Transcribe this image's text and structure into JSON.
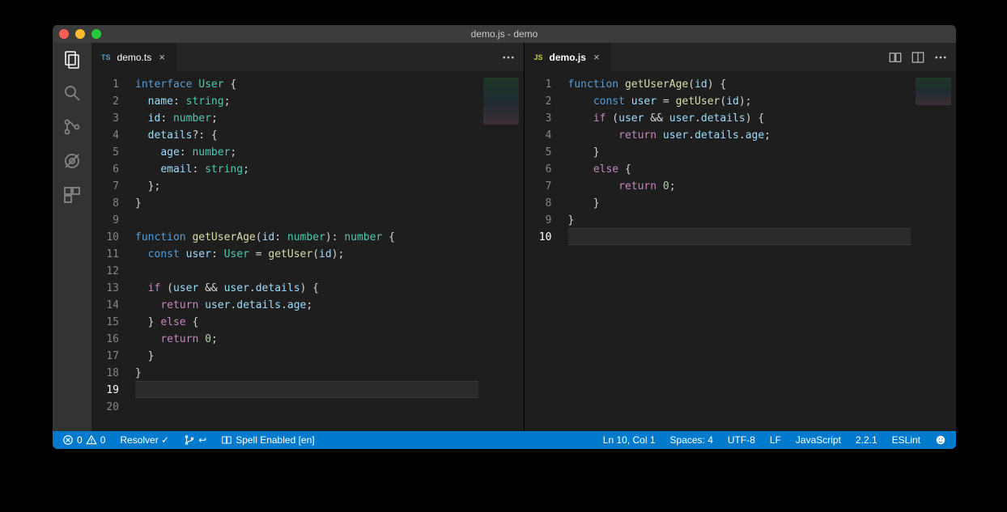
{
  "window": {
    "title": "demo.js - demo"
  },
  "leftEditor": {
    "tab": {
      "lang": "TS",
      "name": "demo.ts"
    },
    "lines": [
      [
        {
          "t": "interface ",
          "c": "kw"
        },
        {
          "t": "User ",
          "c": "type"
        },
        {
          "t": "{",
          "c": "pun"
        }
      ],
      [
        {
          "t": "  ",
          "c": ""
        },
        {
          "t": "name",
          "c": "var"
        },
        {
          "t": ": ",
          "c": "pun"
        },
        {
          "t": "string",
          "c": "type"
        },
        {
          "t": ";",
          "c": "pun"
        }
      ],
      [
        {
          "t": "  ",
          "c": ""
        },
        {
          "t": "id",
          "c": "var"
        },
        {
          "t": ": ",
          "c": "pun"
        },
        {
          "t": "number",
          "c": "type"
        },
        {
          "t": ";",
          "c": "pun"
        }
      ],
      [
        {
          "t": "  ",
          "c": ""
        },
        {
          "t": "details",
          "c": "var"
        },
        {
          "t": "?: {",
          "c": "pun"
        }
      ],
      [
        {
          "t": "    ",
          "c": ""
        },
        {
          "t": "age",
          "c": "var"
        },
        {
          "t": ": ",
          "c": "pun"
        },
        {
          "t": "number",
          "c": "type"
        },
        {
          "t": ";",
          "c": "pun"
        }
      ],
      [
        {
          "t": "    ",
          "c": ""
        },
        {
          "t": "email",
          "c": "var"
        },
        {
          "t": ": ",
          "c": "pun"
        },
        {
          "t": "string",
          "c": "type"
        },
        {
          "t": ";",
          "c": "pun"
        }
      ],
      [
        {
          "t": "  };",
          "c": "pun"
        }
      ],
      [
        {
          "t": "}",
          "c": "pun"
        }
      ],
      [
        {
          "t": "",
          "c": ""
        }
      ],
      [
        {
          "t": "function ",
          "c": "kw"
        },
        {
          "t": "getUserAge",
          "c": "fn"
        },
        {
          "t": "(",
          "c": "pun"
        },
        {
          "t": "id",
          "c": "var"
        },
        {
          "t": ": ",
          "c": "pun"
        },
        {
          "t": "number",
          "c": "type"
        },
        {
          "t": "): ",
          "c": "pun"
        },
        {
          "t": "number ",
          "c": "type"
        },
        {
          "t": "{",
          "c": "pun"
        }
      ],
      [
        {
          "t": "  ",
          "c": ""
        },
        {
          "t": "const ",
          "c": "kw"
        },
        {
          "t": "user",
          "c": "var"
        },
        {
          "t": ": ",
          "c": "pun"
        },
        {
          "t": "User",
          "c": "type"
        },
        {
          "t": " = ",
          "c": "pun"
        },
        {
          "t": "getUser",
          "c": "fn"
        },
        {
          "t": "(",
          "c": "pun"
        },
        {
          "t": "id",
          "c": "var"
        },
        {
          "t": ");",
          "c": "pun"
        }
      ],
      [
        {
          "t": "",
          "c": ""
        }
      ],
      [
        {
          "t": "  ",
          "c": ""
        },
        {
          "t": "if ",
          "c": "kw2"
        },
        {
          "t": "(",
          "c": "pun"
        },
        {
          "t": "user",
          "c": "var"
        },
        {
          "t": " && ",
          "c": "pun"
        },
        {
          "t": "user",
          "c": "var"
        },
        {
          "t": ".",
          "c": "pun"
        },
        {
          "t": "details",
          "c": "var"
        },
        {
          "t": ") {",
          "c": "pun"
        }
      ],
      [
        {
          "t": "    ",
          "c": ""
        },
        {
          "t": "return ",
          "c": "kw2"
        },
        {
          "t": "user",
          "c": "var"
        },
        {
          "t": ".",
          "c": "pun"
        },
        {
          "t": "details",
          "c": "var"
        },
        {
          "t": ".",
          "c": "pun"
        },
        {
          "t": "age",
          "c": "var"
        },
        {
          "t": ";",
          "c": "pun"
        }
      ],
      [
        {
          "t": "  } ",
          "c": "pun"
        },
        {
          "t": "else ",
          "c": "kw2"
        },
        {
          "t": "{",
          "c": "pun"
        }
      ],
      [
        {
          "t": "    ",
          "c": ""
        },
        {
          "t": "return ",
          "c": "kw2"
        },
        {
          "t": "0",
          "c": "num"
        },
        {
          "t": ";",
          "c": "pun"
        }
      ],
      [
        {
          "t": "  }",
          "c": "pun"
        }
      ],
      [
        {
          "t": "}",
          "c": "pun"
        }
      ],
      [
        {
          "t": "",
          "c": ""
        }
      ],
      [
        {
          "t": "",
          "c": ""
        }
      ]
    ],
    "currentLine": 19
  },
  "rightEditor": {
    "tab": {
      "lang": "JS",
      "name": "demo.js"
    },
    "lines": [
      [
        {
          "t": "function ",
          "c": "kw"
        },
        {
          "t": "getUserAge",
          "c": "fn"
        },
        {
          "t": "(",
          "c": "pun"
        },
        {
          "t": "id",
          "c": "var"
        },
        {
          "t": ") {",
          "c": "pun"
        }
      ],
      [
        {
          "t": "    ",
          "c": ""
        },
        {
          "t": "const ",
          "c": "kw"
        },
        {
          "t": "user",
          "c": "var"
        },
        {
          "t": " = ",
          "c": "pun"
        },
        {
          "t": "getUser",
          "c": "fn"
        },
        {
          "t": "(",
          "c": "pun"
        },
        {
          "t": "id",
          "c": "var"
        },
        {
          "t": ");",
          "c": "pun"
        }
      ],
      [
        {
          "t": "    ",
          "c": ""
        },
        {
          "t": "if ",
          "c": "kw2"
        },
        {
          "t": "(",
          "c": "pun"
        },
        {
          "t": "user",
          "c": "var"
        },
        {
          "t": " && ",
          "c": "pun"
        },
        {
          "t": "user",
          "c": "var"
        },
        {
          "t": ".",
          "c": "pun"
        },
        {
          "t": "details",
          "c": "var"
        },
        {
          "t": ") {",
          "c": "pun"
        }
      ],
      [
        {
          "t": "        ",
          "c": ""
        },
        {
          "t": "return ",
          "c": "kw2"
        },
        {
          "t": "user",
          "c": "var"
        },
        {
          "t": ".",
          "c": "pun"
        },
        {
          "t": "details",
          "c": "var"
        },
        {
          "t": ".",
          "c": "pun"
        },
        {
          "t": "age",
          "c": "var"
        },
        {
          "t": ";",
          "c": "pun"
        }
      ],
      [
        {
          "t": "    }",
          "c": "pun"
        }
      ],
      [
        {
          "t": "    ",
          "c": ""
        },
        {
          "t": "else ",
          "c": "kw2"
        },
        {
          "t": "{",
          "c": "pun"
        }
      ],
      [
        {
          "t": "        ",
          "c": ""
        },
        {
          "t": "return ",
          "c": "kw2"
        },
        {
          "t": "0",
          "c": "num"
        },
        {
          "t": ";",
          "c": "pun"
        }
      ],
      [
        {
          "t": "    }",
          "c": "pun"
        }
      ],
      [
        {
          "t": "}",
          "c": "pun"
        }
      ],
      [
        {
          "t": "",
          "c": ""
        }
      ]
    ],
    "currentLine": 10
  },
  "status": {
    "errors": "0",
    "warnings": "0",
    "resolver": "Resolver ✓",
    "spell": "Spell Enabled [en]",
    "lncol": "Ln 10, Col 1",
    "spaces": "Spaces: 4",
    "encoding": "UTF-8",
    "eol": "LF",
    "lang": "JavaScript",
    "version": "2.2.1",
    "eslint": "ESLint"
  }
}
